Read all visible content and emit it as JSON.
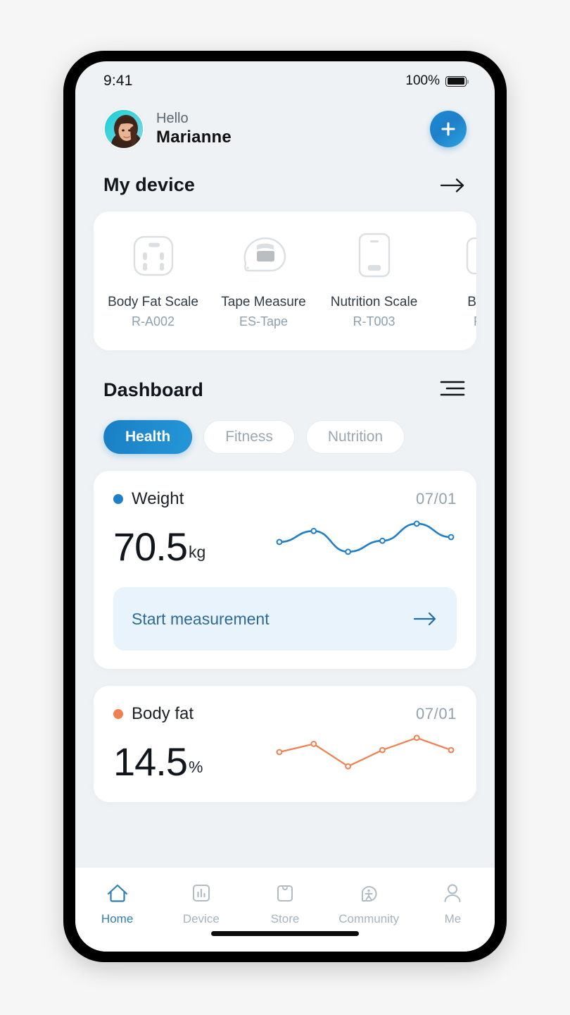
{
  "theme": {
    "accent_blue": "#1f7fc9",
    "accent_blue_light": "#2aa3e0",
    "orange": "#ef8050",
    "screen_bg": "#eef2f5",
    "card_bg": "#ffffff",
    "muted_text": "#8ea0ad"
  },
  "status_bar": {
    "time": "9:41",
    "battery_percent": "100%",
    "battery_icon": "battery-full-icon"
  },
  "header": {
    "greeting": "Hello",
    "user_name": "Marianne",
    "avatar_icon": "user-avatar",
    "add_button_icon": "plus-icon"
  },
  "my_device": {
    "title": "My device",
    "more_icon": "arrow-right-icon",
    "devices": [
      {
        "name": "Body Fat Scale",
        "model": "R-A002",
        "icon": "body-fat-scale-icon"
      },
      {
        "name": "Tape Measure",
        "model": "ES-Tape",
        "icon": "tape-measure-icon"
      },
      {
        "name": "Nutrition Scale",
        "model": "R-T003",
        "icon": "nutrition-scale-icon"
      },
      {
        "name": "Blood",
        "model": "RP-",
        "icon": "blood-pressure-icon"
      }
    ]
  },
  "dashboard": {
    "title": "Dashboard",
    "list_icon": "list-view-icon",
    "tabs": [
      {
        "label": "Health",
        "active": true
      },
      {
        "label": "Fitness",
        "active": false
      },
      {
        "label": "Nutrition",
        "active": false
      }
    ],
    "cards": [
      {
        "label": "Weight",
        "date": "07/01",
        "value": "70.5",
        "unit": "kg",
        "dot_color": "#1f7fc9",
        "cta_label": "Start measurement",
        "cta_icon": "arrow-right-icon"
      },
      {
        "label": "Body fat",
        "date": "07/01",
        "value": "14.5",
        "unit": "%",
        "dot_color": "#ef8050"
      }
    ]
  },
  "chart_data": [
    {
      "type": "line",
      "title": "Weight",
      "unit": "kg",
      "series_name": "Weight",
      "color": "#1f7fc9",
      "smooth": true,
      "x": [
        1,
        2,
        3,
        4,
        5,
        6
      ],
      "values": [
        70.1,
        71.0,
        69.3,
        70.2,
        71.6,
        70.5
      ],
      "ylim": [
        69.0,
        72.0
      ],
      "grid": false,
      "legend": "none",
      "xlabel": "",
      "ylabel": ""
    },
    {
      "type": "line",
      "title": "Body fat",
      "unit": "%",
      "series_name": "Body fat",
      "color": "#ef8050",
      "smooth": false,
      "x": [
        1,
        2,
        3,
        4,
        5,
        6
      ],
      "values": [
        14.4,
        14.8,
        13.7,
        14.5,
        15.1,
        14.5
      ],
      "ylim": [
        13.5,
        15.3
      ],
      "grid": false,
      "legend": "none",
      "xlabel": "",
      "ylabel": ""
    }
  ],
  "tabbar": {
    "items": [
      {
        "label": "Home",
        "icon": "home-icon",
        "active": true
      },
      {
        "label": "Device",
        "icon": "chart-bar-icon",
        "active": false
      },
      {
        "label": "Store",
        "icon": "shopping-bag-icon",
        "active": false
      },
      {
        "label": "Community",
        "icon": "community-person-icon",
        "active": false
      },
      {
        "label": "Me",
        "icon": "person-icon",
        "active": false
      }
    ]
  }
}
